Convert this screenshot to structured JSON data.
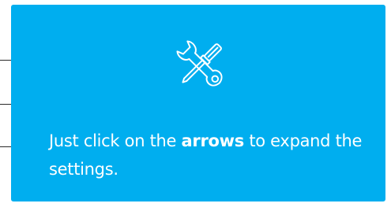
{
  "tooltip": {
    "icon": "tools-icon",
    "text_before": "Just click on the ",
    "text_bold": "arrows",
    "text_after": " to expand the settings."
  },
  "colors": {
    "card_background": "#00aeef",
    "text": "#ffffff",
    "page_background": "#ffffff"
  }
}
